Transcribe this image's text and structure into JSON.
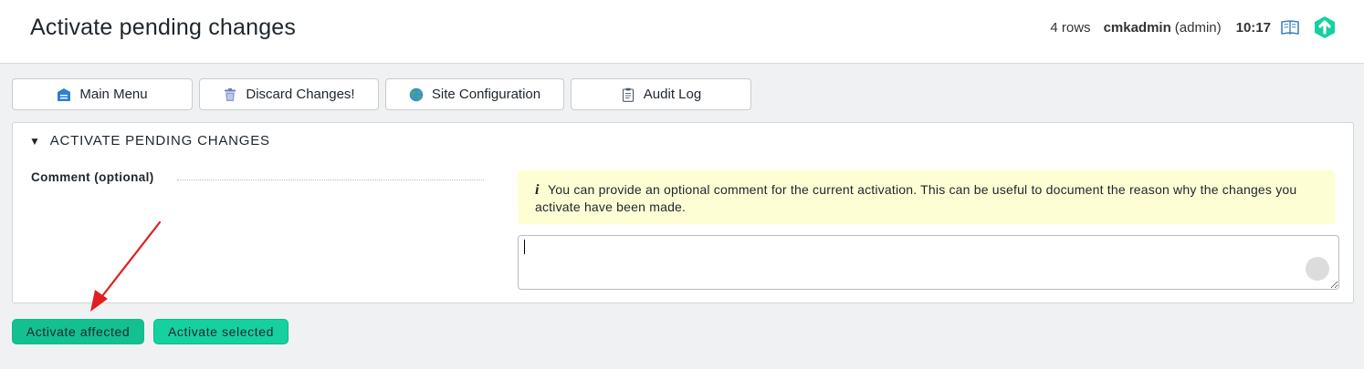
{
  "header": {
    "title": "Activate pending changes",
    "rows_count": "4 rows",
    "username": "cmkadmin",
    "user_role": "(admin)",
    "time": "10:17",
    "help_icon": "book-icon",
    "logo_icon": "checkmk-logo-icon"
  },
  "toolbar": {
    "main_menu": "Main Menu",
    "discard_changes": "Discard Changes!",
    "site_configuration": "Site Configuration",
    "audit_log": "Audit Log"
  },
  "panel": {
    "title": "ACTIVATE PENDING CHANGES",
    "comment_label": "Comment (optional)",
    "info_text": "You can provide an optional comment for the current activation. This can be useful to document the reason why the changes you activate have been made.",
    "comment_value": ""
  },
  "actions": {
    "activate_affected": "Activate affected",
    "activate_selected": "Activate selected"
  },
  "colors": {
    "accent_green": "#15d1a0",
    "info_background": "#fefed4",
    "annotation_arrow": "#e02020"
  }
}
